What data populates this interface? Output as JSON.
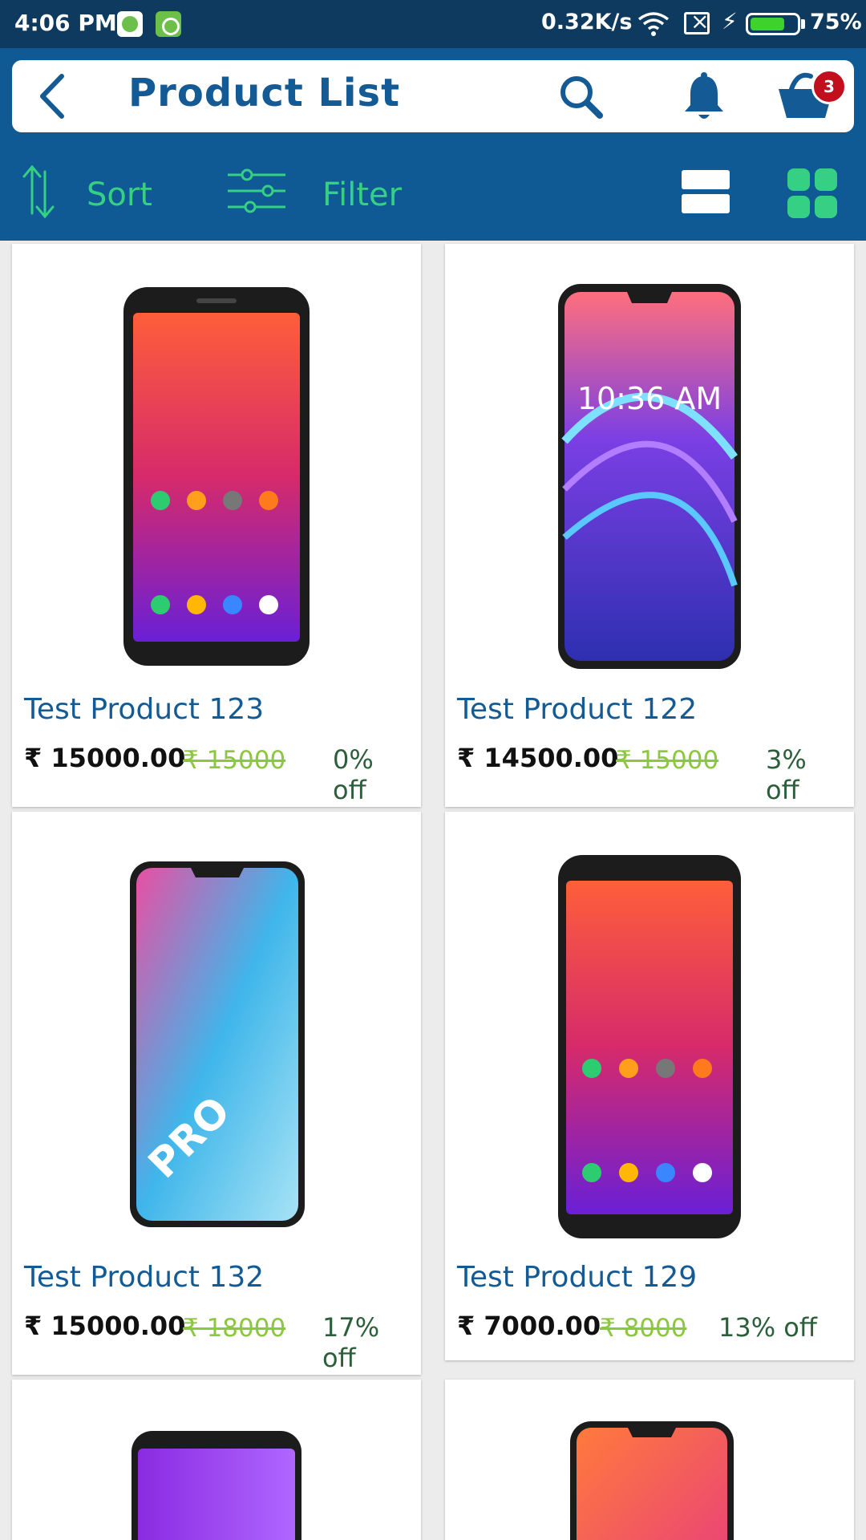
{
  "status_bar": {
    "time": "4:06 PM",
    "network_speed": "0.32K/s",
    "battery_percent": "75%",
    "battery_level": 0.75,
    "icons": [
      "app-icon",
      "app-icon",
      "wifi-icon",
      "sim-off-icon",
      "charging-icon",
      "battery-icon"
    ]
  },
  "header": {
    "title": "Product List",
    "cart_count": "3",
    "icons": [
      "back-arrow-icon",
      "search-icon",
      "bell-icon",
      "cart-icon"
    ]
  },
  "toolbar": {
    "sort_label": "Sort",
    "filter_label": "Filter",
    "icons": [
      "sort-icon",
      "filter-sliders-icon",
      "list-view-icon",
      "grid-view-icon"
    ]
  },
  "products": [
    {
      "name": "Test Product 123",
      "price": "₹ 15000.00",
      "mrp": "₹ 15000",
      "discount": "0% off"
    },
    {
      "name": "Test Product 122",
      "price": "₹ 14500.00",
      "mrp": "₹ 15000",
      "discount": "3% off"
    },
    {
      "name": "Test Product 132",
      "price": "₹ 15000.00",
      "mrp": "₹ 18000",
      "discount": "17% off"
    },
    {
      "name": "Test Product 129",
      "price": "₹ 7000.00",
      "mrp": "₹ 8000",
      "discount": "13% off"
    }
  ],
  "colors": {
    "header": "#0f5a94",
    "statusbar": "#0d3a5e",
    "accent": "#35d083",
    "product_name": "#145a94",
    "mrp": "#8dc63f",
    "badge": "#c10f1d"
  }
}
